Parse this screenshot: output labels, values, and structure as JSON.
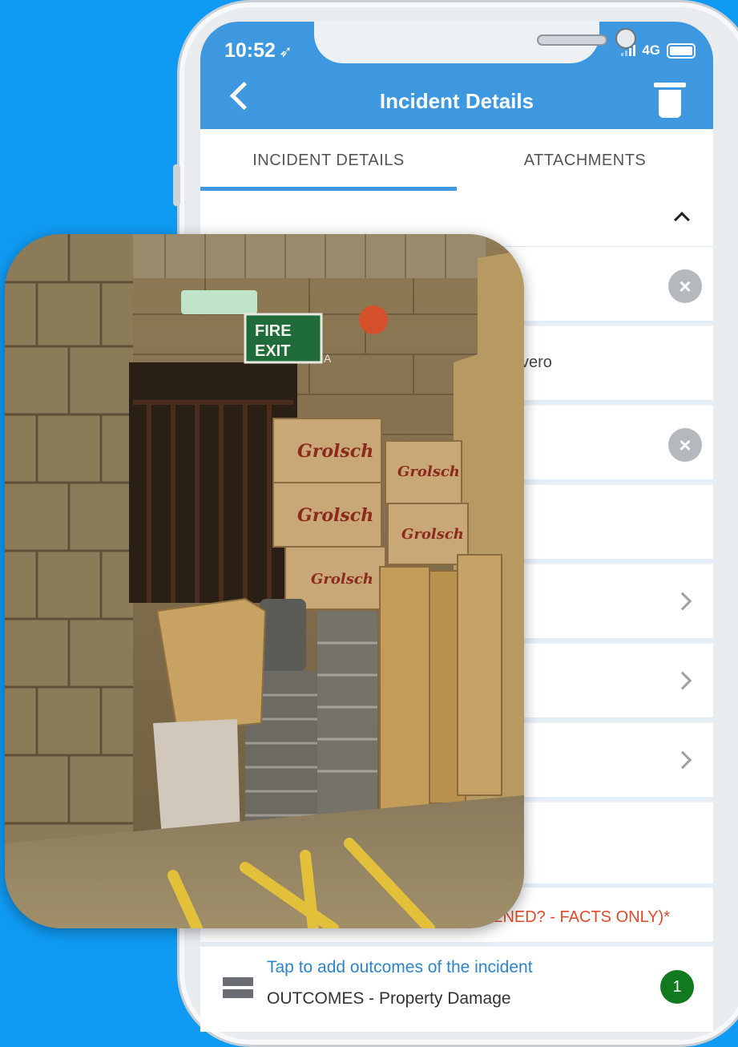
{
  "status_bar": {
    "time": "10:52",
    "network": "4G"
  },
  "header": {
    "title": "Incident Details"
  },
  "tabs": [
    {
      "label": "INCIDENT DETAILS",
      "active": true
    },
    {
      "label": "ATTACHMENTS",
      "active": false
    }
  ],
  "rows": [
    {
      "value": ""
    },
    {
      "value": "vero"
    },
    {
      "value": ""
    }
  ],
  "description": {
    "label": "APPENED? - FACTS ONLY)*"
  },
  "outcomes": {
    "link": "Tap to add outcomes of the incident",
    "subtitle": "OUTCOMES - Property Damage",
    "count": "1"
  },
  "photo": {
    "sign_line1": "FIRE",
    "sign_line2": "EXIT",
    "wall_tag": "A",
    "brand": "Grolsch"
  },
  "colors": {
    "background": "#0f9bf4",
    "header": "#3d98e0",
    "required_label": "#e04a2b",
    "badge": "#117a1f"
  },
  "icons": [
    "location-arrow-icon",
    "signal-icon",
    "battery-icon",
    "back-icon",
    "trash-icon",
    "chevron-up-icon",
    "clear-icon",
    "chevron-right-icon",
    "menu-icon"
  ]
}
